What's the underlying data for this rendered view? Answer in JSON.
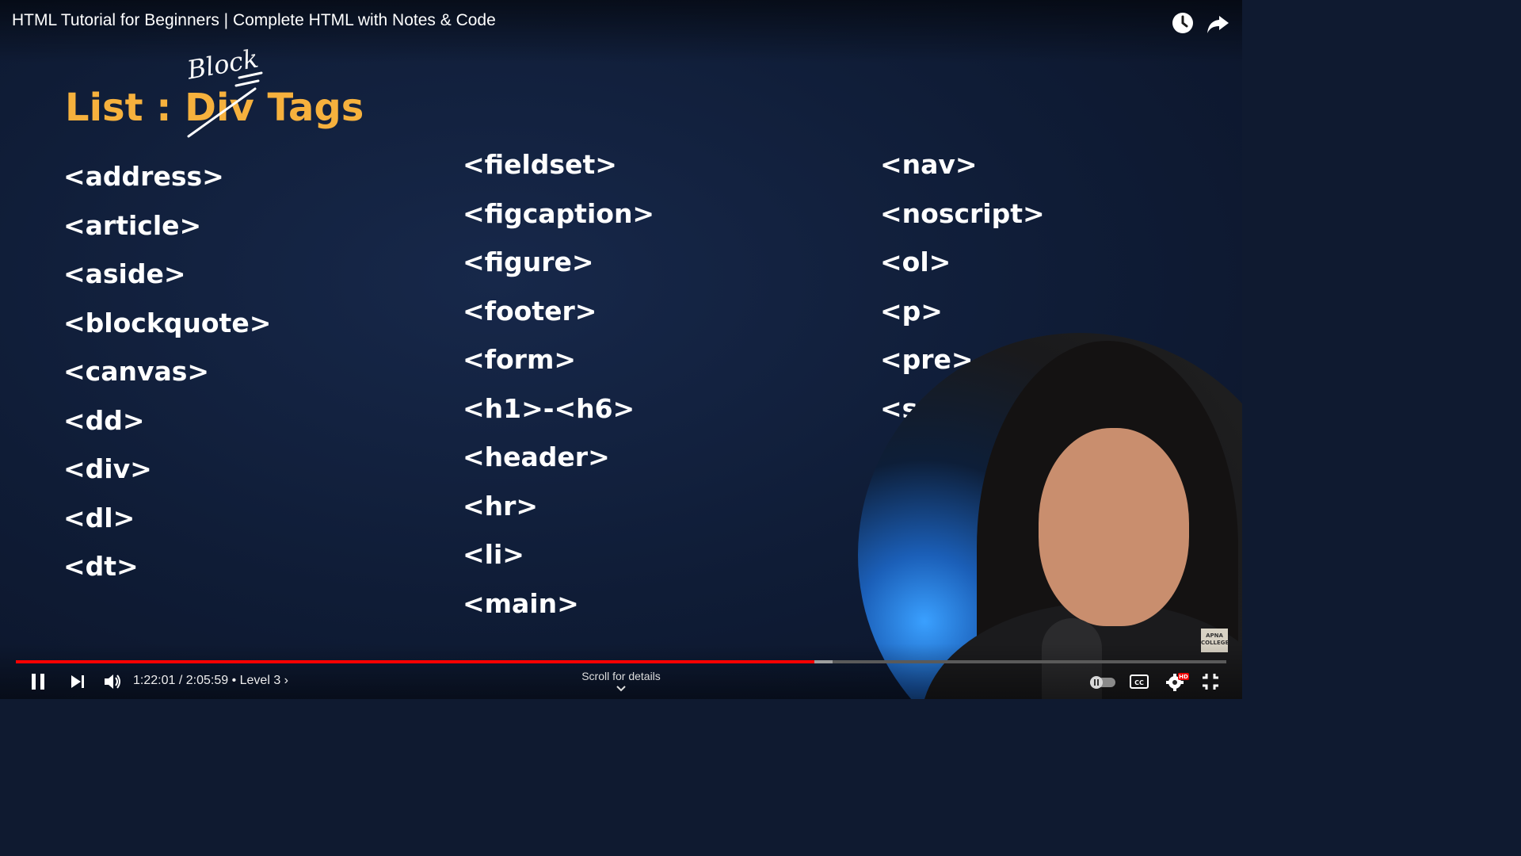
{
  "player": {
    "title": "HTML Tutorial for Beginners | Complete HTML with Notes & Code",
    "top_icons": [
      "watch-later-icon",
      "share-icon"
    ]
  },
  "slide": {
    "title_prefix": "List : ",
    "struck_word": "Div",
    "title_suffix": " Tags",
    "handwritten_note": "Block",
    "columns": [
      [
        "<address>",
        "<article>",
        "<aside>",
        "<blockquote>",
        "<canvas>",
        "<dd>",
        "<div>",
        "<dl>",
        "<dt>"
      ],
      [
        "<fieldset>",
        "<figcaption>",
        "<figure>",
        "<footer>",
        "<form>",
        "<h1>-<h6>",
        "<header>",
        "<hr>",
        "<li>",
        "<main>"
      ],
      [
        "<nav>",
        "<noscript>",
        "<ol>",
        "<p>",
        "<pre>",
        "<s"
      ]
    ],
    "logo_text": "APNA COLLEGE"
  },
  "controls": {
    "current_time": "1:22:01",
    "separator": " / ",
    "duration": "2:05:59",
    "chapter": " • Level 3 ›",
    "scroll_hint": "Scroll for details",
    "progress_played_fraction": 0.66,
    "progress_buffered_fraction": 0.675,
    "colors": {
      "played": "#ff0000",
      "buffered": "#9e9e9e",
      "track": "#5a5a5a",
      "accent": "#f6b13d"
    }
  }
}
